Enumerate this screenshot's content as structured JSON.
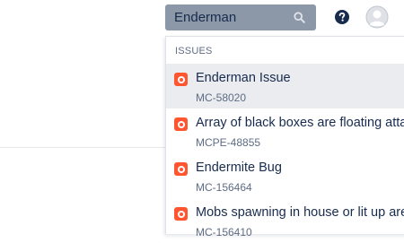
{
  "header": {
    "search_value": "Enderman",
    "search_icon": "search-icon",
    "help_icon": "help-icon",
    "avatar_icon": "user-avatar-icon"
  },
  "dropdown": {
    "section_title": "ISSUES",
    "items": [
      {
        "title": "Enderman Issue",
        "key": "MC-58020",
        "icon": "bug-icon"
      },
      {
        "title": "Array of black boxes are floating attac",
        "key": "MCPE-48855",
        "icon": "bug-icon"
      },
      {
        "title": "Endermite Bug",
        "key": "MC-156464",
        "icon": "bug-icon"
      },
      {
        "title": "Mobs spawning in house or lit up area",
        "key": "MC-156410",
        "icon": "bug-icon"
      }
    ]
  },
  "colors": {
    "search_bg": "#8c97a8",
    "highlight_bg": "#ebecf0",
    "bug_red": "#ff5630",
    "text_dark": "#172b4d",
    "text_muted": "#5e6c84"
  }
}
